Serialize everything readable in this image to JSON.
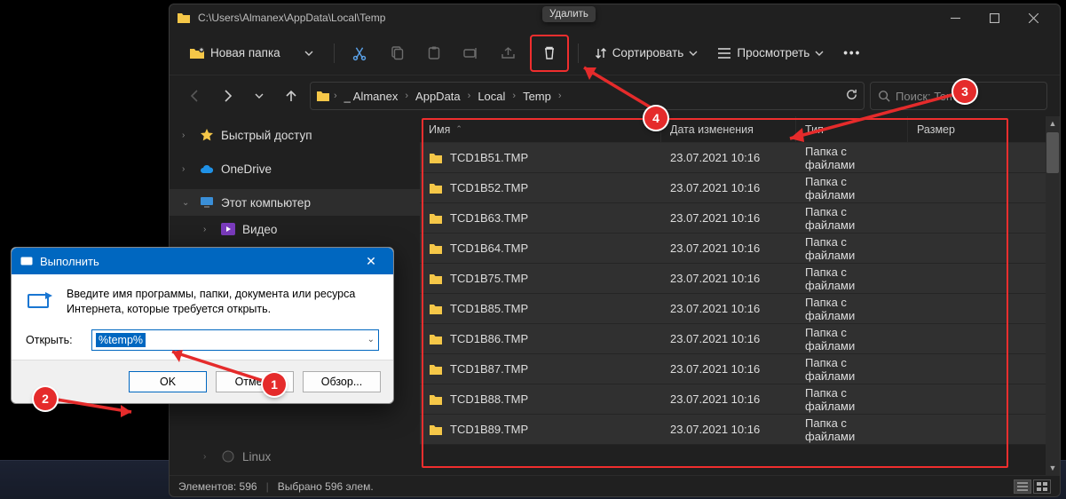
{
  "explorer": {
    "title_path": "C:\\Users\\Almanex\\AppData\\Local\\Temp",
    "tooltip_delete": "Удалить",
    "newfolder": "Новая папка",
    "sort": "Сортировать",
    "view": "Просмотреть",
    "breadcrumbs": [
      "_ Almanex",
      "AppData",
      "Local",
      "Temp"
    ],
    "search_placeholder": "Поиск: Temp",
    "sidebar": {
      "quick": "Быстрый доступ",
      "onedrive": "OneDrive",
      "thispc": "Этот компьютер",
      "video": "Видео",
      "linux": "Linux"
    },
    "cols": {
      "name": "Имя",
      "date": "Дата изменения",
      "type": "Тип",
      "size": "Размер"
    },
    "rows": [
      {
        "name": "TCD1B51.TMP",
        "date": "23.07.2021 10:16",
        "type": "Папка с файлами"
      },
      {
        "name": "TCD1B52.TMP",
        "date": "23.07.2021 10:16",
        "type": "Папка с файлами"
      },
      {
        "name": "TCD1B63.TMP",
        "date": "23.07.2021 10:16",
        "type": "Папка с файлами"
      },
      {
        "name": "TCD1B64.TMP",
        "date": "23.07.2021 10:16",
        "type": "Папка с файлами"
      },
      {
        "name": "TCD1B75.TMP",
        "date": "23.07.2021 10:16",
        "type": "Папка с файлами"
      },
      {
        "name": "TCD1B85.TMP",
        "date": "23.07.2021 10:16",
        "type": "Папка с файлами"
      },
      {
        "name": "TCD1B86.TMP",
        "date": "23.07.2021 10:16",
        "type": "Папка с файлами"
      },
      {
        "name": "TCD1B87.TMP",
        "date": "23.07.2021 10:16",
        "type": "Папка с файлами"
      },
      {
        "name": "TCD1B88.TMP",
        "date": "23.07.2021 10:16",
        "type": "Папка с файлами"
      },
      {
        "name": "TCD1B89.TMP",
        "date": "23.07.2021 10:16",
        "type": "Папка с файлами"
      }
    ],
    "status": {
      "items": "Элементов: 596",
      "selected": "Выбрано 596 элем."
    }
  },
  "run": {
    "title": "Выполнить",
    "message": "Введите имя программы, папки, документа или ресурса Интернета, которые требуется открыть.",
    "open_label": "Открыть:",
    "value": "%temp%",
    "ok": "OK",
    "cancel": "Отмена",
    "browse": "Обзор..."
  },
  "callouts": {
    "c1": "1",
    "c2": "2",
    "c3": "3",
    "c4": "4"
  }
}
